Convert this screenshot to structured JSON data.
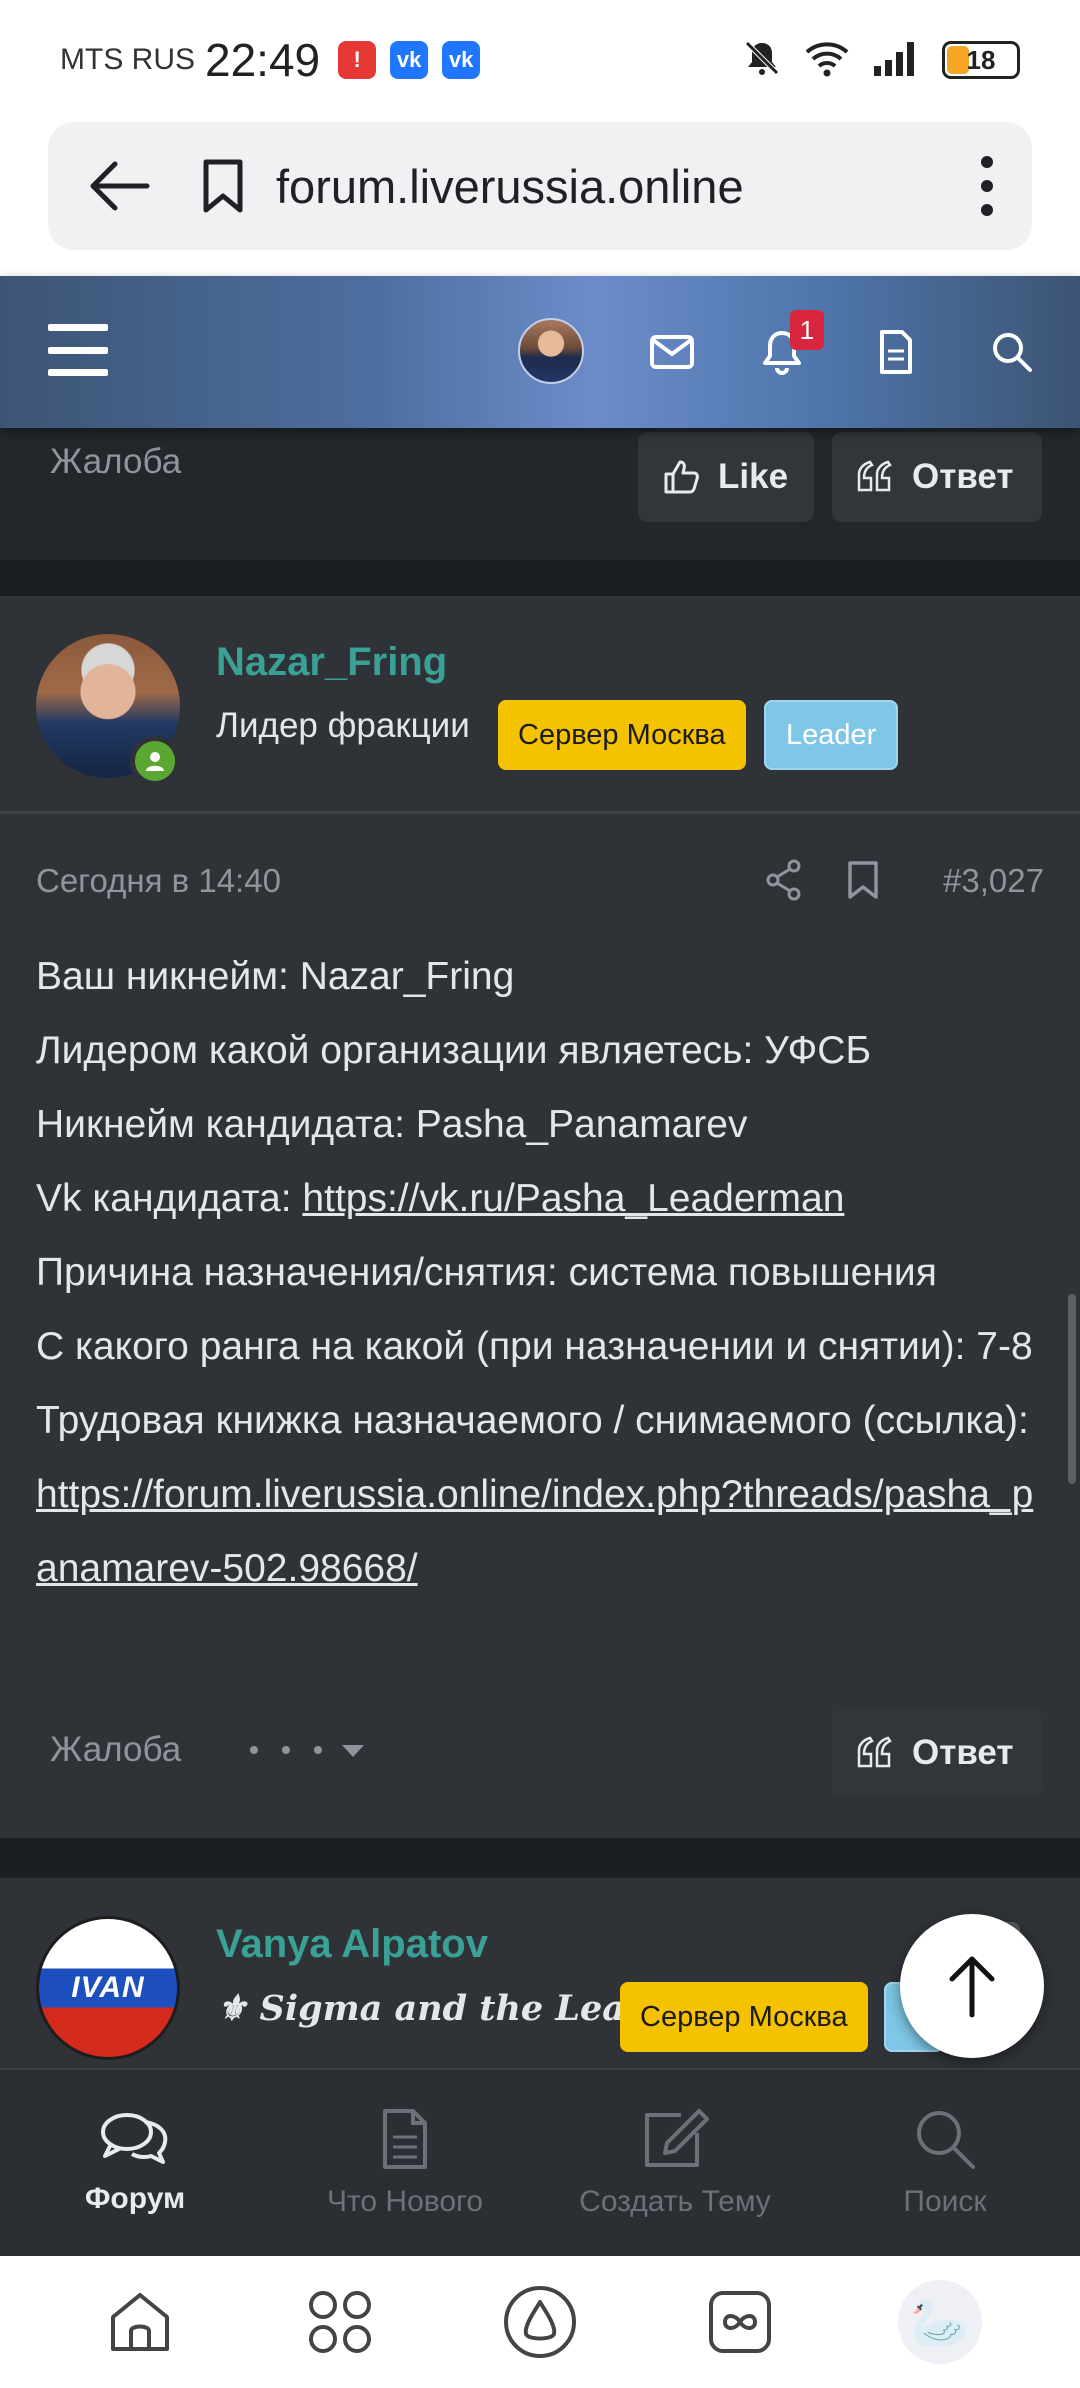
{
  "status_bar": {
    "carrier": "MTS RUS",
    "time": "22:49",
    "battery": "18",
    "app_badges": [
      "!",
      "vk",
      "vk"
    ]
  },
  "browser": {
    "url": "forum.liverussia.online"
  },
  "header": {
    "notification_count": "1"
  },
  "post1": {
    "complaint_label": "Жалоба",
    "like_label": "Like",
    "reply_label": "Ответ"
  },
  "post2": {
    "username": "Nazar_Fring",
    "user_title": "Лидер фракции",
    "badge_server": "Сервер Москва",
    "badge_role": "Leader",
    "date": "Сегодня в 14:40",
    "post_number": "#3,027",
    "lines": {
      "l1": "Ваш никнейм: Nazar_Fring",
      "l2": "Лидером какой организации являетесь: УФСБ",
      "l3": "Никнейм кандидата: Pasha_Panamarev",
      "l4_label": "Vk кандидата: ",
      "l4_link": "https://vk.ru/Pasha_Leaderman",
      "l5": "Причина назначения/снятия: система повышения",
      "l6": "С какого ранга на какой (при назначении и снятии): 7-8",
      "l7_label": "Трудовая книжка назначаемого / снимаемого (ссылка): ",
      "l7_link": "https://forum.liverussia.online/index.php?threads/pasha_panamarev-502.98668/"
    },
    "complaint_label": "Жалоба",
    "reply_label": "Ответ"
  },
  "post3": {
    "username": "Vanya Alpatov",
    "user_title": "⚜ Sigma and the Leader ⚜",
    "badge_server": "Сервер Москва",
    "avatar_text": "IVAN"
  },
  "tabbar": {
    "items": [
      {
        "label": "Форум",
        "icon": "forum-icon"
      },
      {
        "label": "Что Нового",
        "icon": "document-icon"
      },
      {
        "label": "Создать Тему",
        "icon": "edit-icon"
      },
      {
        "label": "Поиск",
        "icon": "search-icon"
      }
    ]
  },
  "colors": {
    "username": "#3aa196",
    "badge_server": "#f5c200",
    "badge_leader": "#7ec7e6",
    "online": "#5aa832"
  }
}
